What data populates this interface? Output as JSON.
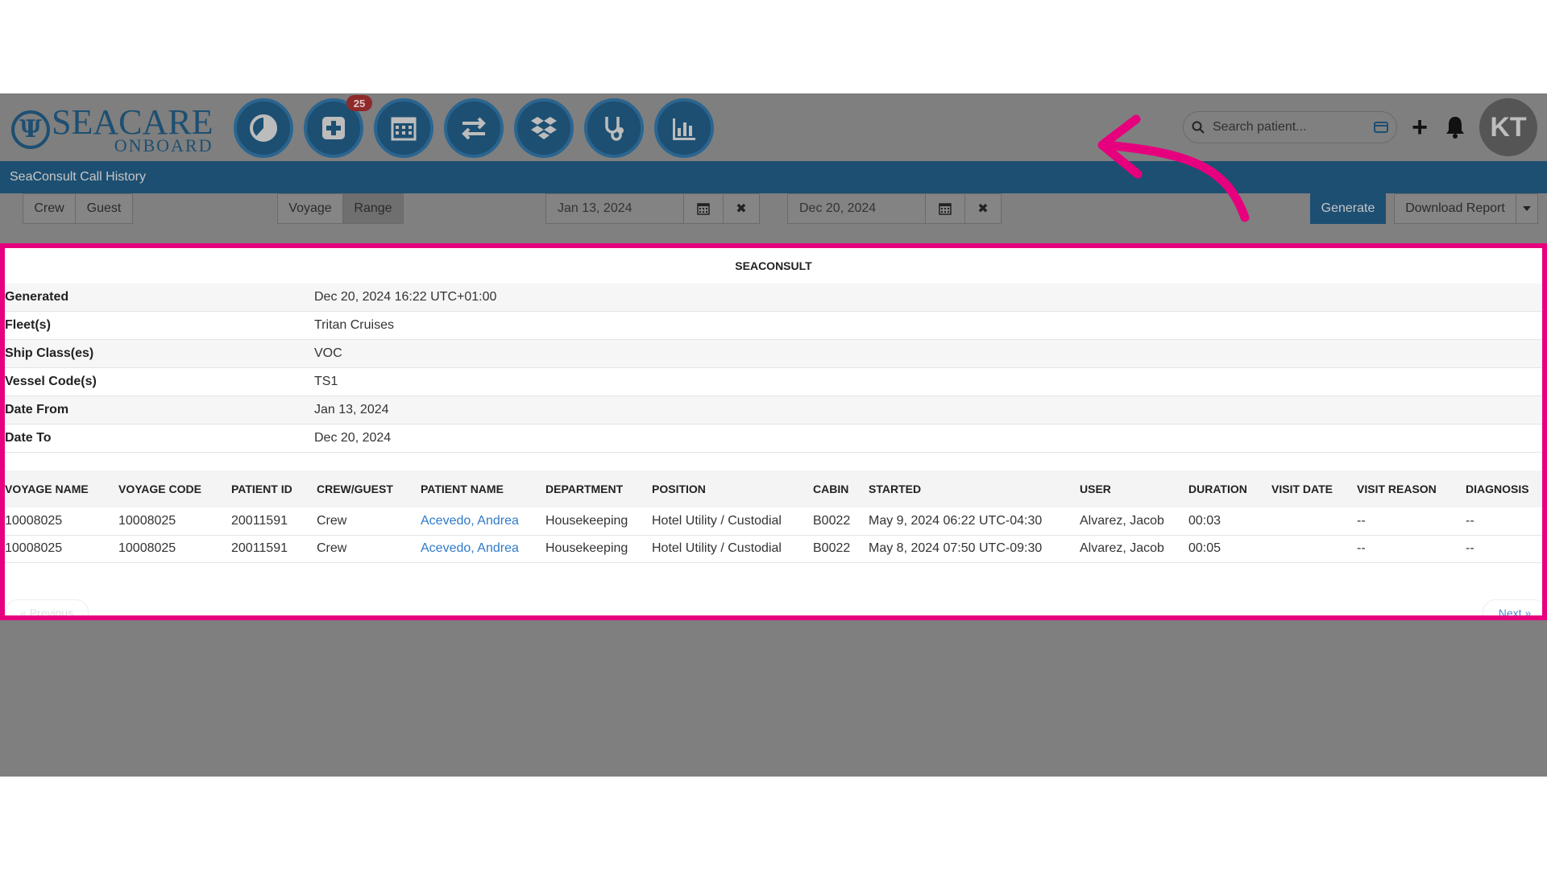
{
  "logo": {
    "line1": "SEACARE",
    "line2": "ONBOARD"
  },
  "nav": {
    "icons": [
      "dashboard-pie-icon",
      "medical-plus-icon",
      "calendar-icon",
      "transfer-icon",
      "dropbox-icon",
      "stethoscope-icon",
      "bar-chart-icon"
    ],
    "badge": "25"
  },
  "header": {
    "search_placeholder": "Search patient...",
    "avatar_initials": "KT"
  },
  "page": {
    "title": "SeaConsult Call History"
  },
  "toolbar": {
    "crew": "Crew",
    "guest": "Guest",
    "voyage": "Voyage",
    "range": "Range",
    "date_from": "Jan 13, 2024",
    "date_to": "Dec 20, 2024",
    "generate": "Generate",
    "download": "Download Report"
  },
  "report": {
    "title": "SEACONSULT",
    "meta": [
      {
        "key": "Generated",
        "value": "Dec 20, 2024 16:22 UTC+01:00"
      },
      {
        "key": "Fleet(s)",
        "value": "Tritan Cruises"
      },
      {
        "key": "Ship Class(es)",
        "value": "VOC"
      },
      {
        "key": "Vessel Code(s)",
        "value": "TS1"
      },
      {
        "key": "Date From",
        "value": "Jan 13, 2024"
      },
      {
        "key": "Date To",
        "value": "Dec 20, 2024"
      }
    ],
    "columns": [
      "VOYAGE NAME",
      "VOYAGE CODE",
      "PATIENT ID",
      "CREW/GUEST",
      "PATIENT NAME",
      "DEPARTMENT",
      "POSITION",
      "CABIN",
      "STARTED",
      "USER",
      "DURATION",
      "VISIT DATE",
      "VISIT REASON",
      "DIAGNOSIS"
    ],
    "rows": [
      [
        "10008025",
        "10008025",
        "20011591",
        "Crew",
        "Acevedo, Andrea",
        "Housekeeping",
        "Hotel Utility / Custodial",
        "B0022",
        "May 9, 2024 06:22 UTC-04:30",
        "Alvarez, Jacob",
        "00:03",
        "",
        "--",
        "--"
      ],
      [
        "10008025",
        "10008025",
        "20011591",
        "Crew",
        "Acevedo, Andrea",
        "Housekeeping",
        "Hotel Utility / Custodial",
        "B0022",
        "May 8, 2024 07:50 UTC-09:30",
        "Alvarez, Jacob",
        "00:05",
        "",
        "--",
        "--"
      ]
    ],
    "prev": "« Previous",
    "next": "Next »"
  },
  "colors": {
    "brand": "#1d4f72",
    "highlight": "#e6007e",
    "link": "#2f7ac9"
  }
}
